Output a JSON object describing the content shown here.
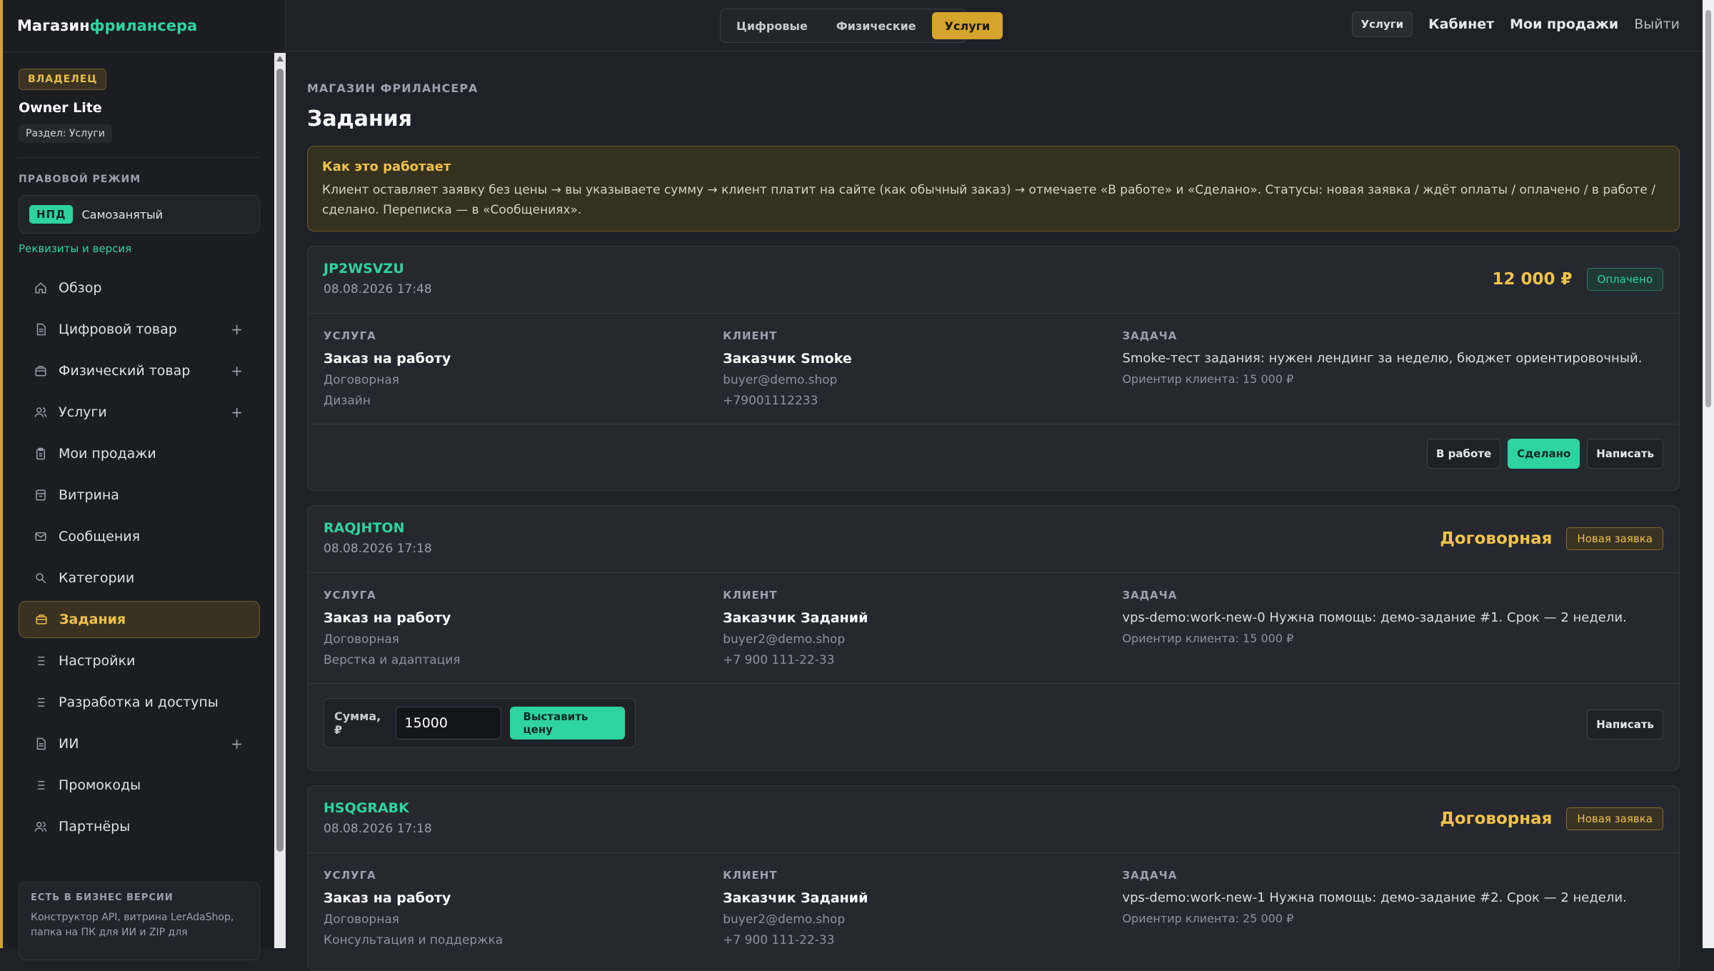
{
  "brand": {
    "part1": "Магазин",
    "part2": "фрилансера"
  },
  "sidebar": {
    "role_badge": "ВЛАДЕЛЕЦ",
    "owner_name": "Owner Lite",
    "section_chip": "Раздел: Услуги",
    "legal_title": "ПРАВОВОЙ РЕЖИМ",
    "legal_badge": "НПД",
    "legal_value": "Самозанятый",
    "legal_link": "Реквизиты и версия",
    "items": [
      {
        "label": "Обзор",
        "icon": "home-icon",
        "plus": false
      },
      {
        "label": "Цифровой товар",
        "icon": "document-icon",
        "plus": true
      },
      {
        "label": "Физический товар",
        "icon": "box-icon",
        "plus": true
      },
      {
        "label": "Услуги",
        "icon": "users-icon",
        "plus": true
      },
      {
        "label": "Мои продажи",
        "icon": "clipboard-icon",
        "plus": false
      },
      {
        "label": "Витрина",
        "icon": "storefront-icon",
        "plus": false
      },
      {
        "label": "Сообщения",
        "icon": "mail-icon",
        "plus": false
      },
      {
        "label": "Категории",
        "icon": "search-icon",
        "plus": false
      },
      {
        "label": "Задания",
        "icon": "briefcase-icon",
        "plus": false,
        "active": true
      },
      {
        "label": "Настройки",
        "icon": "list-icon",
        "plus": false
      },
      {
        "label": "Разработка и доступы",
        "icon": "list-icon",
        "plus": false
      },
      {
        "label": "ИИ",
        "icon": "document-icon",
        "plus": true
      },
      {
        "label": "Промокоды",
        "icon": "list-icon",
        "plus": false
      },
      {
        "label": "Партнёры",
        "icon": "users-icon",
        "plus": false
      }
    ],
    "plus_glyph": "+",
    "business": {
      "title": "ЕСТЬ В БИЗНЕС ВЕРСИИ",
      "text": "Конструктор API, витрина LerAdaShop, папка на ПК для ИИ и ZIP для"
    }
  },
  "topbar": {
    "segments": [
      "Цифровые",
      "Физические",
      "Услуги"
    ],
    "active_segment": 2,
    "chip": "Услуги",
    "links": [
      "Кабинет",
      "Мои продажи"
    ],
    "logout": "Выйти"
  },
  "main": {
    "eyebrow": "МАГАЗИН ФРИЛАНСЕРА",
    "title": "Задания",
    "info": {
      "title": "Как это работает",
      "text": "Клиент оставляет заявку без цены → вы указываете сумму → клиент платит на сайте (как обычный заказ) → отмечаете «В работе» и «Сделано». Статусы: новая заявка / ждёт оплаты / оплачено / в работе / сделано. Переписка — в «Сообщениях»."
    },
    "labels": {
      "service": "УСЛУГА",
      "client": "КЛИЕНТ",
      "task": "ЗАДАЧА"
    },
    "cards": [
      {
        "id": "JP2WSVZU",
        "date": "08.08.2026 17:48",
        "price": "12 000 ₽",
        "status": "Оплачено",
        "service": "Заказ на работу",
        "service_price": "Договорная",
        "service_cat": "Дизайн",
        "client": "Заказчик Smoke",
        "email": "buyer@demo.shop",
        "phone": "+79001112233",
        "task": "Smoke-тест задания: нужен лендинг за неделю, бюджет ориентировочный.",
        "budget": "Ориентир клиента: 15 000 ₽",
        "actions": [
          "В работе",
          "Сделано",
          "Написать"
        ]
      },
      {
        "id": "RAQJHTON",
        "date": "08.08.2026 17:18",
        "price": "Договорная",
        "status": "Новая заявка",
        "service": "Заказ на работу",
        "service_price": "Договорная",
        "service_cat": "Верстка и адаптация",
        "client": "Заказчик Заданий",
        "email": "buyer2@demo.shop",
        "phone": "+7 900 111-22-33",
        "task": "vps-demo:work-new-0 Нужна помощь: демо-задание #1. Срок — 2 недели.",
        "budget": "Ориентир клиента: 15 000 ₽",
        "price_form": {
          "label": "Сумма, ₽",
          "value": "15000",
          "button": "Выставить цену"
        },
        "write": "Написать"
      },
      {
        "id": "HSQGRABK",
        "date": "08.08.2026 17:18",
        "price": "Договорная",
        "status": "Новая заявка",
        "service": "Заказ на работу",
        "service_price": "Договорная",
        "service_cat": "Консультация и поддержка",
        "client": "Заказчик Заданий",
        "email": "buyer2@demo.shop",
        "phone": "+7 900 111-22-33",
        "task": "vps-demo:work-new-1 Нужна помощь: демо-задание #2. Срок — 2 недели.",
        "budget": "Ориентир клиента: 25 000 ₽"
      }
    ]
  }
}
